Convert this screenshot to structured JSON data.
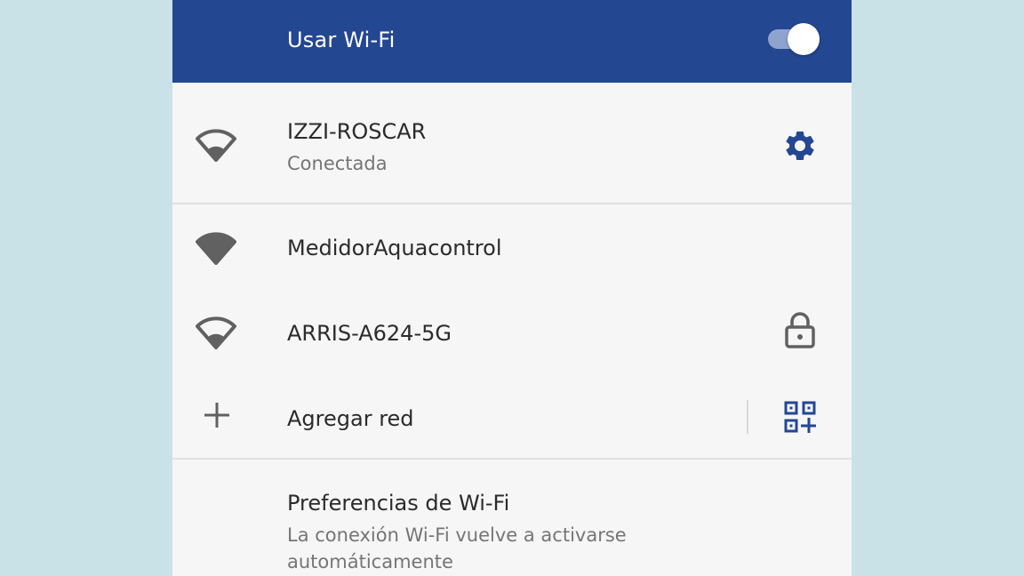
{
  "header": {
    "title": "Usar Wi-Fi",
    "wifi_enabled": true
  },
  "connected_network": {
    "name": "IZZI-ROSCAR",
    "status": "Conectada",
    "icon": "wifi-outline-icon",
    "action_icon": "gear-icon"
  },
  "networks": [
    {
      "name": "MedidorAquacontrol",
      "icon": "wifi-filled-icon",
      "secured": false
    },
    {
      "name": "ARRIS-A624-5G",
      "icon": "wifi-outline-icon",
      "secured": true,
      "action_icon": "lock-icon"
    }
  ],
  "add_network": {
    "label": "Agregar red",
    "icon": "plus-icon",
    "action_icon": "qr-scan-icon"
  },
  "preferences": {
    "title": "Preferencias de Wi-Fi",
    "subtitle_line1": "La conexión Wi-Fi vuelve a activarse",
    "subtitle_line2": "automáticamente"
  },
  "colors": {
    "header_bg": "#244792",
    "accent": "#244792",
    "background": "#c8e2e8",
    "panel": "#f6f6f6"
  }
}
